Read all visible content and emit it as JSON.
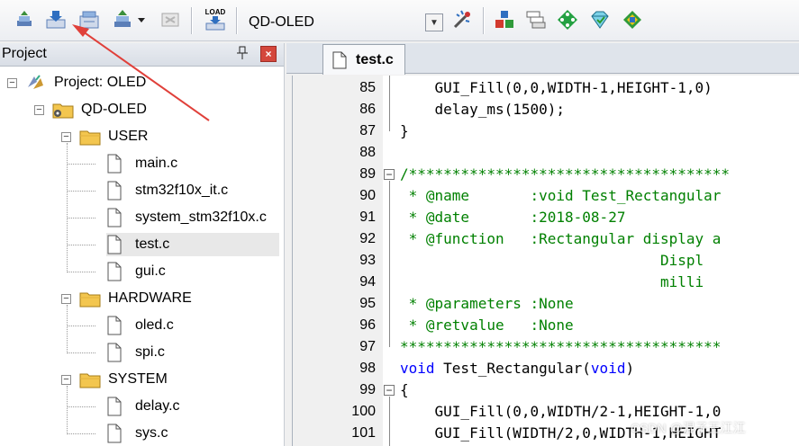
{
  "toolbar": {
    "target": "QD-OLED",
    "buttons": [
      "translate-icon",
      "build-icon",
      "rebuild-icon",
      "batch-build-icon",
      "dropdown-icon",
      "stop-build-icon",
      "download-icon",
      "target-options-icon",
      "manage-components-icon",
      "select-packs-icon",
      "run-env-icon",
      "pack-installer-icon"
    ],
    "download_label": "LOAD"
  },
  "project": {
    "title": "Project",
    "pin": "ㅁ",
    "close": "×",
    "tree": [
      {
        "label": "Project: OLED",
        "kind": "project"
      },
      {
        "label": "QD-OLED",
        "kind": "target"
      },
      {
        "label": "USER",
        "kind": "folder"
      },
      {
        "label": "main.c",
        "kind": "file"
      },
      {
        "label": "stm32f10x_it.c",
        "kind": "file"
      },
      {
        "label": "system_stm32f10x.c",
        "kind": "file"
      },
      {
        "label": "test.c",
        "kind": "file",
        "selected": true
      },
      {
        "label": "gui.c",
        "kind": "file"
      },
      {
        "label": "HARDWARE",
        "kind": "folder"
      },
      {
        "label": "oled.c",
        "kind": "file"
      },
      {
        "label": "spi.c",
        "kind": "file"
      },
      {
        "label": "SYSTEM",
        "kind": "folder"
      },
      {
        "label": "delay.c",
        "kind": "file"
      },
      {
        "label": "sys.c",
        "kind": "file"
      }
    ]
  },
  "editor": {
    "tab": "test.c",
    "lines": [
      {
        "n": "85",
        "text": "    GUI_Fill(0,0,WIDTH-1,HEIGHT-1,0)"
      },
      {
        "n": "86",
        "text": "    delay_ms(1500);"
      },
      {
        "n": "87",
        "text": "}"
      },
      {
        "n": "88",
        "text": ""
      },
      {
        "n": "89",
        "text": "/*************************************"
      },
      {
        "n": "90",
        "text": " * @name       :void Test_Rectangular"
      },
      {
        "n": "91",
        "text": " * @date       :2018-08-27"
      },
      {
        "n": "92",
        "text": " * @function   :Rectangular display a"
      },
      {
        "n": "93",
        "text": "                              Displ"
      },
      {
        "n": "94",
        "text": "                              milli"
      },
      {
        "n": "95",
        "text": " * @parameters :None"
      },
      {
        "n": "96",
        "text": " * @retvalue   :None"
      },
      {
        "n": "97",
        "text": "*************************************"
      },
      {
        "n": "98",
        "text": "void Test_Rectangular(void)"
      },
      {
        "n": "99",
        "text": "{"
      },
      {
        "n": "100",
        "text": "    GUI_Fill(0,0,WIDTH/2-1,HEIGHT-1,0"
      },
      {
        "n": "101",
        "text": "    GUI_Fill(WIDTH/2,0,WIDTH-1,HEIGHT"
      }
    ]
  },
  "watermark": "CSDN @混子王江江",
  "colors": {
    "keyword": "#0000ff",
    "comment": "#008000",
    "arrow": "#e0403a"
  }
}
